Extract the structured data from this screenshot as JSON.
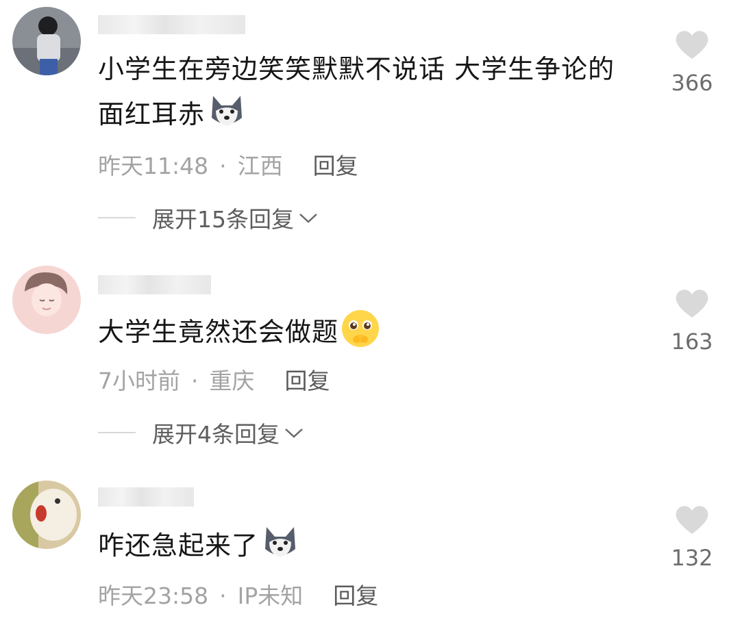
{
  "comments": [
    {
      "text": "小学生在旁边笑笑默默不说话 大学生争论的面红耳赤",
      "emoji": "husky-dog-emoji",
      "time": "昨天11:48",
      "location": "江西",
      "reply_label": "回复",
      "expand_label": "展开15条回复",
      "likes": "366"
    },
    {
      "text": "大学生竟然还会做题",
      "emoji": "pleading-face-emoji",
      "time": "7小时前",
      "location": "重庆",
      "reply_label": "回复",
      "expand_label": "展开4条回复",
      "likes": "163"
    },
    {
      "text": "咋还急起来了",
      "emoji": "husky-dog-emoji",
      "time": "昨天23:58",
      "location": "IP未知",
      "reply_label": "回复",
      "likes": "132"
    }
  ],
  "separator": "·",
  "icons": {
    "like": "heart-icon",
    "expand": "chevron-down-icon"
  },
  "colors": {
    "text": "#161616",
    "meta": "#a3a3a3",
    "reply": "#5b5b5b",
    "heart": "#d9d9d9"
  }
}
